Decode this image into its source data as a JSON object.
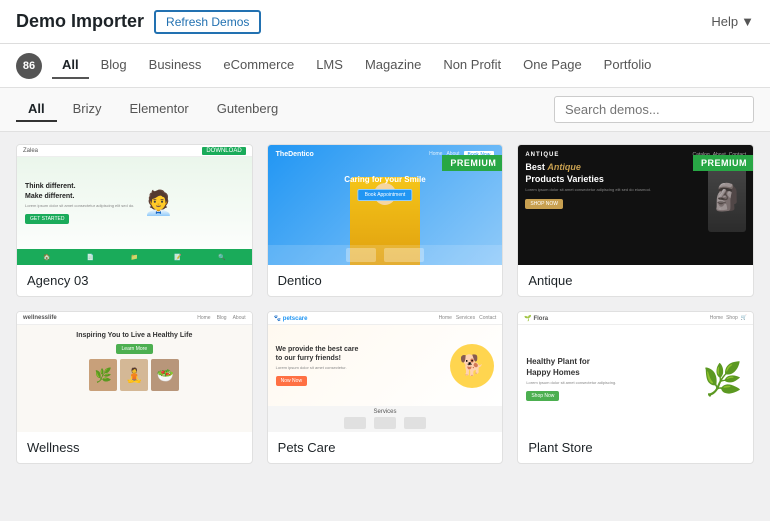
{
  "header": {
    "title": "Demo Importer",
    "refresh_label": "Refresh Demos",
    "help_label": "Help",
    "help_icon": "▼"
  },
  "filter_bar": {
    "count": "86",
    "tabs": [
      {
        "id": "all",
        "label": "All",
        "active": true
      },
      {
        "id": "blog",
        "label": "Blog",
        "active": false
      },
      {
        "id": "business",
        "label": "Business",
        "active": false
      },
      {
        "id": "ecommerce",
        "label": "eCommerce",
        "active": false
      },
      {
        "id": "lms",
        "label": "LMS",
        "active": false
      },
      {
        "id": "magazine",
        "label": "Magazine",
        "active": false
      },
      {
        "id": "non-profit",
        "label": "Non Profit",
        "active": false
      },
      {
        "id": "one-page",
        "label": "One Page",
        "active": false
      },
      {
        "id": "portfolio",
        "label": "Portfolio",
        "active": false
      }
    ]
  },
  "sub_filter": {
    "tabs": [
      {
        "id": "all",
        "label": "All",
        "active": true
      },
      {
        "id": "brizy",
        "label": "Brizy",
        "active": false
      },
      {
        "id": "elementor",
        "label": "Elementor",
        "active": false
      },
      {
        "id": "gutenberg",
        "label": "Gutenberg",
        "active": false
      }
    ],
    "search_placeholder": "Search demos..."
  },
  "demos": [
    {
      "id": "agency-03",
      "label": "Agency 03",
      "premium": false,
      "thumb_type": "agency"
    },
    {
      "id": "dentico",
      "label": "Dentico",
      "premium": true,
      "thumb_type": "dentico"
    },
    {
      "id": "antique",
      "label": "Antique",
      "premium": true,
      "thumb_type": "antique"
    },
    {
      "id": "wellness",
      "label": "Wellness",
      "premium": false,
      "thumb_type": "wellness"
    },
    {
      "id": "pets",
      "label": "Pets Care",
      "premium": false,
      "thumb_type": "pets"
    },
    {
      "id": "plant",
      "label": "Plant Store",
      "premium": false,
      "thumb_type": "plant"
    }
  ],
  "premium_label": "PREMIUM"
}
